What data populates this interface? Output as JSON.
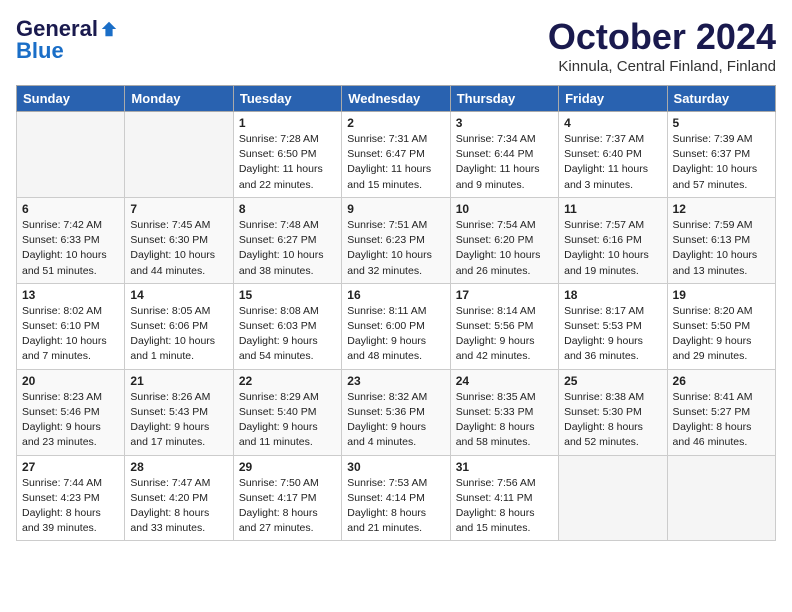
{
  "logo": {
    "general": "General",
    "blue": "Blue"
  },
  "title": "October 2024",
  "location": "Kinnula, Central Finland, Finland",
  "days_header": [
    "Sunday",
    "Monday",
    "Tuesday",
    "Wednesday",
    "Thursday",
    "Friday",
    "Saturday"
  ],
  "weeks": [
    [
      {
        "day": "",
        "sunrise": "",
        "sunset": "",
        "daylight": "",
        "empty": true
      },
      {
        "day": "",
        "sunrise": "",
        "sunset": "",
        "daylight": "",
        "empty": true
      },
      {
        "day": "1",
        "sunrise": "Sunrise: 7:28 AM",
        "sunset": "Sunset: 6:50 PM",
        "daylight": "Daylight: 11 hours and 22 minutes.",
        "empty": false
      },
      {
        "day": "2",
        "sunrise": "Sunrise: 7:31 AM",
        "sunset": "Sunset: 6:47 PM",
        "daylight": "Daylight: 11 hours and 15 minutes.",
        "empty": false
      },
      {
        "day": "3",
        "sunrise": "Sunrise: 7:34 AM",
        "sunset": "Sunset: 6:44 PM",
        "daylight": "Daylight: 11 hours and 9 minutes.",
        "empty": false
      },
      {
        "day": "4",
        "sunrise": "Sunrise: 7:37 AM",
        "sunset": "Sunset: 6:40 PM",
        "daylight": "Daylight: 11 hours and 3 minutes.",
        "empty": false
      },
      {
        "day": "5",
        "sunrise": "Sunrise: 7:39 AM",
        "sunset": "Sunset: 6:37 PM",
        "daylight": "Daylight: 10 hours and 57 minutes.",
        "empty": false
      }
    ],
    [
      {
        "day": "6",
        "sunrise": "Sunrise: 7:42 AM",
        "sunset": "Sunset: 6:33 PM",
        "daylight": "Daylight: 10 hours and 51 minutes.",
        "empty": false
      },
      {
        "day": "7",
        "sunrise": "Sunrise: 7:45 AM",
        "sunset": "Sunset: 6:30 PM",
        "daylight": "Daylight: 10 hours and 44 minutes.",
        "empty": false
      },
      {
        "day": "8",
        "sunrise": "Sunrise: 7:48 AM",
        "sunset": "Sunset: 6:27 PM",
        "daylight": "Daylight: 10 hours and 38 minutes.",
        "empty": false
      },
      {
        "day": "9",
        "sunrise": "Sunrise: 7:51 AM",
        "sunset": "Sunset: 6:23 PM",
        "daylight": "Daylight: 10 hours and 32 minutes.",
        "empty": false
      },
      {
        "day": "10",
        "sunrise": "Sunrise: 7:54 AM",
        "sunset": "Sunset: 6:20 PM",
        "daylight": "Daylight: 10 hours and 26 minutes.",
        "empty": false
      },
      {
        "day": "11",
        "sunrise": "Sunrise: 7:57 AM",
        "sunset": "Sunset: 6:16 PM",
        "daylight": "Daylight: 10 hours and 19 minutes.",
        "empty": false
      },
      {
        "day": "12",
        "sunrise": "Sunrise: 7:59 AM",
        "sunset": "Sunset: 6:13 PM",
        "daylight": "Daylight: 10 hours and 13 minutes.",
        "empty": false
      }
    ],
    [
      {
        "day": "13",
        "sunrise": "Sunrise: 8:02 AM",
        "sunset": "Sunset: 6:10 PM",
        "daylight": "Daylight: 10 hours and 7 minutes.",
        "empty": false
      },
      {
        "day": "14",
        "sunrise": "Sunrise: 8:05 AM",
        "sunset": "Sunset: 6:06 PM",
        "daylight": "Daylight: 10 hours and 1 minute.",
        "empty": false
      },
      {
        "day": "15",
        "sunrise": "Sunrise: 8:08 AM",
        "sunset": "Sunset: 6:03 PM",
        "daylight": "Daylight: 9 hours and 54 minutes.",
        "empty": false
      },
      {
        "day": "16",
        "sunrise": "Sunrise: 8:11 AM",
        "sunset": "Sunset: 6:00 PM",
        "daylight": "Daylight: 9 hours and 48 minutes.",
        "empty": false
      },
      {
        "day": "17",
        "sunrise": "Sunrise: 8:14 AM",
        "sunset": "Sunset: 5:56 PM",
        "daylight": "Daylight: 9 hours and 42 minutes.",
        "empty": false
      },
      {
        "day": "18",
        "sunrise": "Sunrise: 8:17 AM",
        "sunset": "Sunset: 5:53 PM",
        "daylight": "Daylight: 9 hours and 36 minutes.",
        "empty": false
      },
      {
        "day": "19",
        "sunrise": "Sunrise: 8:20 AM",
        "sunset": "Sunset: 5:50 PM",
        "daylight": "Daylight: 9 hours and 29 minutes.",
        "empty": false
      }
    ],
    [
      {
        "day": "20",
        "sunrise": "Sunrise: 8:23 AM",
        "sunset": "Sunset: 5:46 PM",
        "daylight": "Daylight: 9 hours and 23 minutes.",
        "empty": false
      },
      {
        "day": "21",
        "sunrise": "Sunrise: 8:26 AM",
        "sunset": "Sunset: 5:43 PM",
        "daylight": "Daylight: 9 hours and 17 minutes.",
        "empty": false
      },
      {
        "day": "22",
        "sunrise": "Sunrise: 8:29 AM",
        "sunset": "Sunset: 5:40 PM",
        "daylight": "Daylight: 9 hours and 11 minutes.",
        "empty": false
      },
      {
        "day": "23",
        "sunrise": "Sunrise: 8:32 AM",
        "sunset": "Sunset: 5:36 PM",
        "daylight": "Daylight: 9 hours and 4 minutes.",
        "empty": false
      },
      {
        "day": "24",
        "sunrise": "Sunrise: 8:35 AM",
        "sunset": "Sunset: 5:33 PM",
        "daylight": "Daylight: 8 hours and 58 minutes.",
        "empty": false
      },
      {
        "day": "25",
        "sunrise": "Sunrise: 8:38 AM",
        "sunset": "Sunset: 5:30 PM",
        "daylight": "Daylight: 8 hours and 52 minutes.",
        "empty": false
      },
      {
        "day": "26",
        "sunrise": "Sunrise: 8:41 AM",
        "sunset": "Sunset: 5:27 PM",
        "daylight": "Daylight: 8 hours and 46 minutes.",
        "empty": false
      }
    ],
    [
      {
        "day": "27",
        "sunrise": "Sunrise: 7:44 AM",
        "sunset": "Sunset: 4:23 PM",
        "daylight": "Daylight: 8 hours and 39 minutes.",
        "empty": false
      },
      {
        "day": "28",
        "sunrise": "Sunrise: 7:47 AM",
        "sunset": "Sunset: 4:20 PM",
        "daylight": "Daylight: 8 hours and 33 minutes.",
        "empty": false
      },
      {
        "day": "29",
        "sunrise": "Sunrise: 7:50 AM",
        "sunset": "Sunset: 4:17 PM",
        "daylight": "Daylight: 8 hours and 27 minutes.",
        "empty": false
      },
      {
        "day": "30",
        "sunrise": "Sunrise: 7:53 AM",
        "sunset": "Sunset: 4:14 PM",
        "daylight": "Daylight: 8 hours and 21 minutes.",
        "empty": false
      },
      {
        "day": "31",
        "sunrise": "Sunrise: 7:56 AM",
        "sunset": "Sunset: 4:11 PM",
        "daylight": "Daylight: 8 hours and 15 minutes.",
        "empty": false
      },
      {
        "day": "",
        "sunrise": "",
        "sunset": "",
        "daylight": "",
        "empty": true
      },
      {
        "day": "",
        "sunrise": "",
        "sunset": "",
        "daylight": "",
        "empty": true
      }
    ]
  ]
}
